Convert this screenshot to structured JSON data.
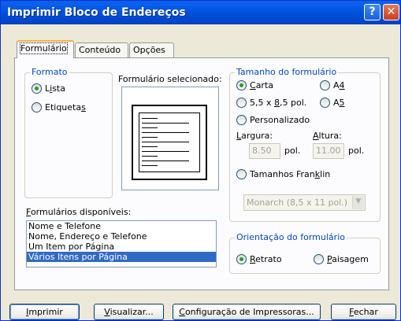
{
  "window": {
    "title": "Imprimir Bloco de Endereços",
    "help_glyph": "?",
    "close_glyph": "✕"
  },
  "tabs": [
    "Formulário",
    "Conteúdo",
    "Opções"
  ],
  "formato": {
    "legend": "Formato",
    "options": [
      {
        "label": "Lista",
        "selected": true
      },
      {
        "label": "Etiquetas",
        "selected": false
      }
    ]
  },
  "preview": {
    "label": "Formulário selecionado:"
  },
  "tamanho": {
    "legend": "Tamanho do formulário",
    "carta": "Carta",
    "a4": "A4",
    "s55": "5,5 x 8,5 pol.",
    "a5": "A5",
    "personalizado": "Personalizado",
    "largura_label": "Largura:",
    "largura_value": "8.50",
    "largura_unit": "pol.",
    "altura_label": "Altura:",
    "altura_value": "11.00",
    "altura_unit": "pol.",
    "franklin": "Tamanhos Franklin",
    "franklin_select": "Monarch  (8,5 x 11 pol.)",
    "selected": "Carta"
  },
  "disponiveis": {
    "label": "Formulários disponíveis:",
    "items": [
      "Nome e Telefone",
      "Nome, Endereço e Telefone",
      "Um Item por Página",
      "Vários Itens por Página"
    ],
    "selected": "Vários Itens por Página"
  },
  "orientacao": {
    "legend": "Orientação do formulário",
    "retrato": "Retrato",
    "paisagem": "Paisagem",
    "selected": "Retrato"
  },
  "buttons": {
    "imprimir": "Imprimir",
    "visualizar": "Visualizar...",
    "configuracao": "Configuração de Impressoras...",
    "fechar": "Fechar"
  }
}
